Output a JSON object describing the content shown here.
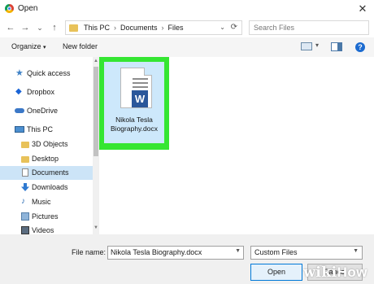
{
  "window": {
    "title": "Open",
    "close_glyph": "✕"
  },
  "nav": {
    "back_glyph": "←",
    "forward_glyph": "→",
    "recent_glyph": "⌄",
    "up_glyph": "↑",
    "breadcrumb": [
      "This PC",
      "Documents",
      "Files"
    ],
    "crumb_separator": "›",
    "search_placeholder": "Search Files"
  },
  "toolbar": {
    "organize_label": "Organize",
    "organize_arrow": "▾",
    "new_folder_label": "New folder",
    "help_glyph": "?"
  },
  "sidebar": {
    "items": [
      {
        "label": "Quick access",
        "icon": "star-icon"
      },
      {
        "label": "Dropbox",
        "icon": "dropbox-icon"
      },
      {
        "label": "OneDrive",
        "icon": "cloud-icon"
      },
      {
        "label": "This PC",
        "icon": "computer-icon"
      },
      {
        "label": "3D Objects",
        "icon": "folder-icon"
      },
      {
        "label": "Desktop",
        "icon": "folder-icon"
      },
      {
        "label": "Documents",
        "icon": "document-icon",
        "selected": true
      },
      {
        "label": "Downloads",
        "icon": "download-icon"
      },
      {
        "label": "Music",
        "icon": "music-icon"
      },
      {
        "label": "Pictures",
        "icon": "picture-icon"
      },
      {
        "label": "Videos",
        "icon": "video-icon"
      }
    ]
  },
  "files": [
    {
      "name_line1": "Nikola Tesla",
      "name_line2": "Biography.docx",
      "badge": "W",
      "highlight_color": "#35e632"
    }
  ],
  "bottom": {
    "file_name_label": "File name:",
    "file_name_value": "Nikola Tesla Biography.docx",
    "file_type_value": "Custom Files",
    "open_label": "Open",
    "cancel_label": "Cancel"
  },
  "watermark": {
    "wiki": "wiki",
    "how": "How"
  },
  "colors": {
    "accent": "#0078d7",
    "selection": "#cce4f7",
    "word_blue": "#2b579a"
  }
}
